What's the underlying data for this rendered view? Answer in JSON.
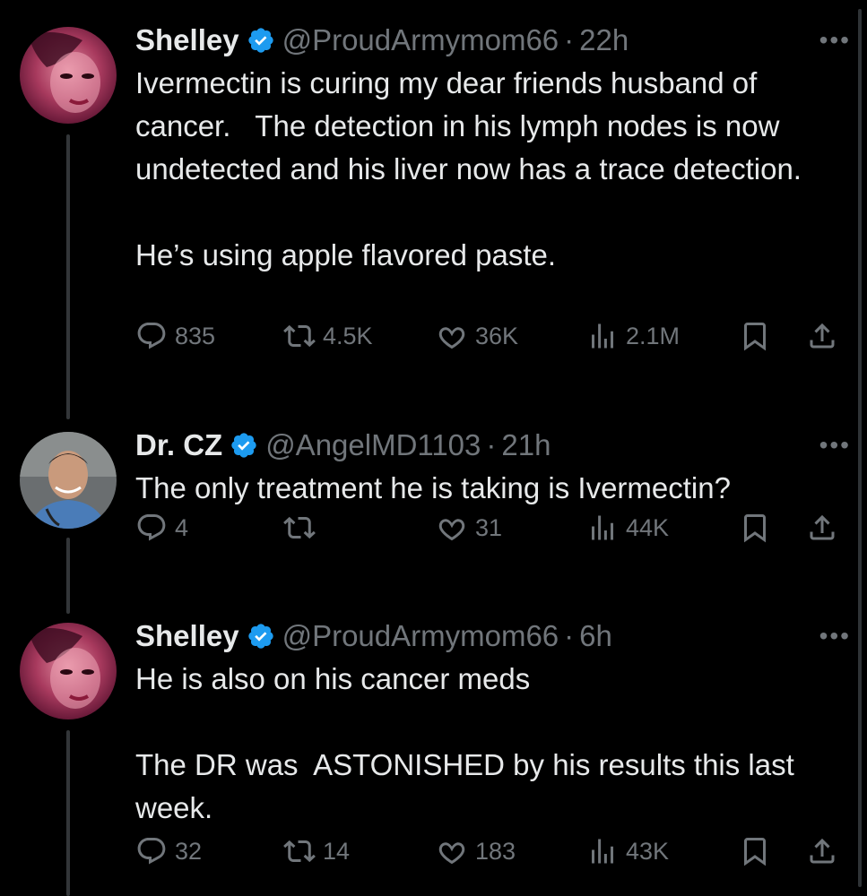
{
  "tweets": [
    {
      "name": "Shelley",
      "handle": "@ProudArmymom66",
      "separator": "·",
      "time": "22h",
      "more": "•••",
      "text": "Ivermectin is curing my dear friends husband of cancer.   The detection in his lymph nodes is now undetected and his liver now has a trace detection.\n\nHe’s using apple flavored paste.",
      "replies": "835",
      "retweets": "4.5K",
      "likes": "36K",
      "views": "2.1M"
    },
    {
      "name": "Dr. CZ",
      "handle": "@AngelMD1103",
      "separator": "·",
      "time": "21h",
      "more": "•••",
      "text": "The only treatment he is taking is Ivermectin?",
      "replies": "4",
      "retweets": "",
      "likes": "31",
      "views": "44K"
    },
    {
      "name": "Shelley",
      "handle": "@ProudArmymom66",
      "separator": "·",
      "time": "6h",
      "more": "•••",
      "text": "He is also on his cancer meds\n\nThe DR was  ASTONISHED by his results this last week.",
      "replies": "32",
      "retweets": "14",
      "likes": "183",
      "views": "43K"
    }
  ],
  "colors": {
    "background": "#000000",
    "text": "#e7e9ea",
    "muted": "#71767b",
    "verified": "#1d9bf0",
    "thread_line": "#333639"
  },
  "icons": [
    "verified-badge-icon",
    "more-icon",
    "reply-icon",
    "retweet-icon",
    "like-icon",
    "views-icon",
    "bookmark-icon",
    "share-icon"
  ]
}
